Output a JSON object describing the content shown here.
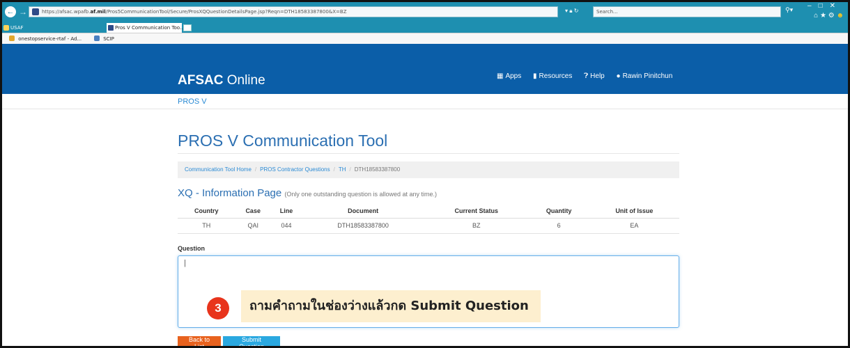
{
  "browser": {
    "url": "https://afsac.wpafb.af.mil/Pros5CommunicationTool/Secure/ProsXQQuestionDetailsPage.jsp?Reqn=DTH18583387800&X=BZ",
    "url_prefix": "https://afsac.wpafb.",
    "url_domain": "af.mil",
    "url_rest": "/Pros5CommunicationTool/Secure/ProsXQQuestionDetailsPage.jsp?Reqn=DTH18583387800&X=BZ",
    "search_placeholder": "Search...",
    "tabs": [
      {
        "label": "USAF"
      },
      {
        "label": "Pros V Communication Too...",
        "close": "×"
      }
    ],
    "favorites": [
      {
        "label": "onestopservice-rtaf - Ad..."
      },
      {
        "label": "SCIP"
      }
    ]
  },
  "site": {
    "brand_bold": "AFSAC",
    "brand_rest": " Online",
    "nav": [
      {
        "label": "Apps",
        "icon": "grid-icon"
      },
      {
        "label": "Resources",
        "icon": "bookmark-icon"
      },
      {
        "label": "Help",
        "icon": "question-circle-icon"
      },
      {
        "label": "Rawin Pinitchun",
        "icon": "user-icon"
      }
    ],
    "subnav": "PROS V"
  },
  "page": {
    "title": "PROS V Communication Tool",
    "breadcrumb": [
      "Communication Tool Home",
      "PROS Contractor Questions",
      "TH",
      "DTH18583387800"
    ],
    "info_heading": "XQ - Information Page",
    "info_note": "(Only one outstanding question is allowed at any time.)",
    "table": {
      "headers": [
        "Country",
        "Case",
        "Line",
        "Document",
        "Current Status",
        "Quantity",
        "Unit of Issue"
      ],
      "rows": [
        [
          "TH",
          "QAI",
          "044",
          "DTH18583387800",
          "BZ",
          "6",
          "EA"
        ]
      ]
    },
    "question_label": "Question",
    "question_value": "|",
    "annotation": {
      "number": "3",
      "text": "ถามคำถามในช่องว่างแล้วกด Submit Question",
      "badge_color": "#e8341c",
      "callout_color": "#fdefcf"
    },
    "buttons": {
      "back": "Back to List",
      "submit": "Submit Question"
    }
  },
  "colors": {
    "navbar": "#0b5ea8",
    "browser_chrome": "#1e8fb0",
    "title_blue": "#2b6fb2",
    "link_blue": "#2a8ad4",
    "back_button": "#e8621e",
    "submit_button": "#2aa8e0"
  }
}
